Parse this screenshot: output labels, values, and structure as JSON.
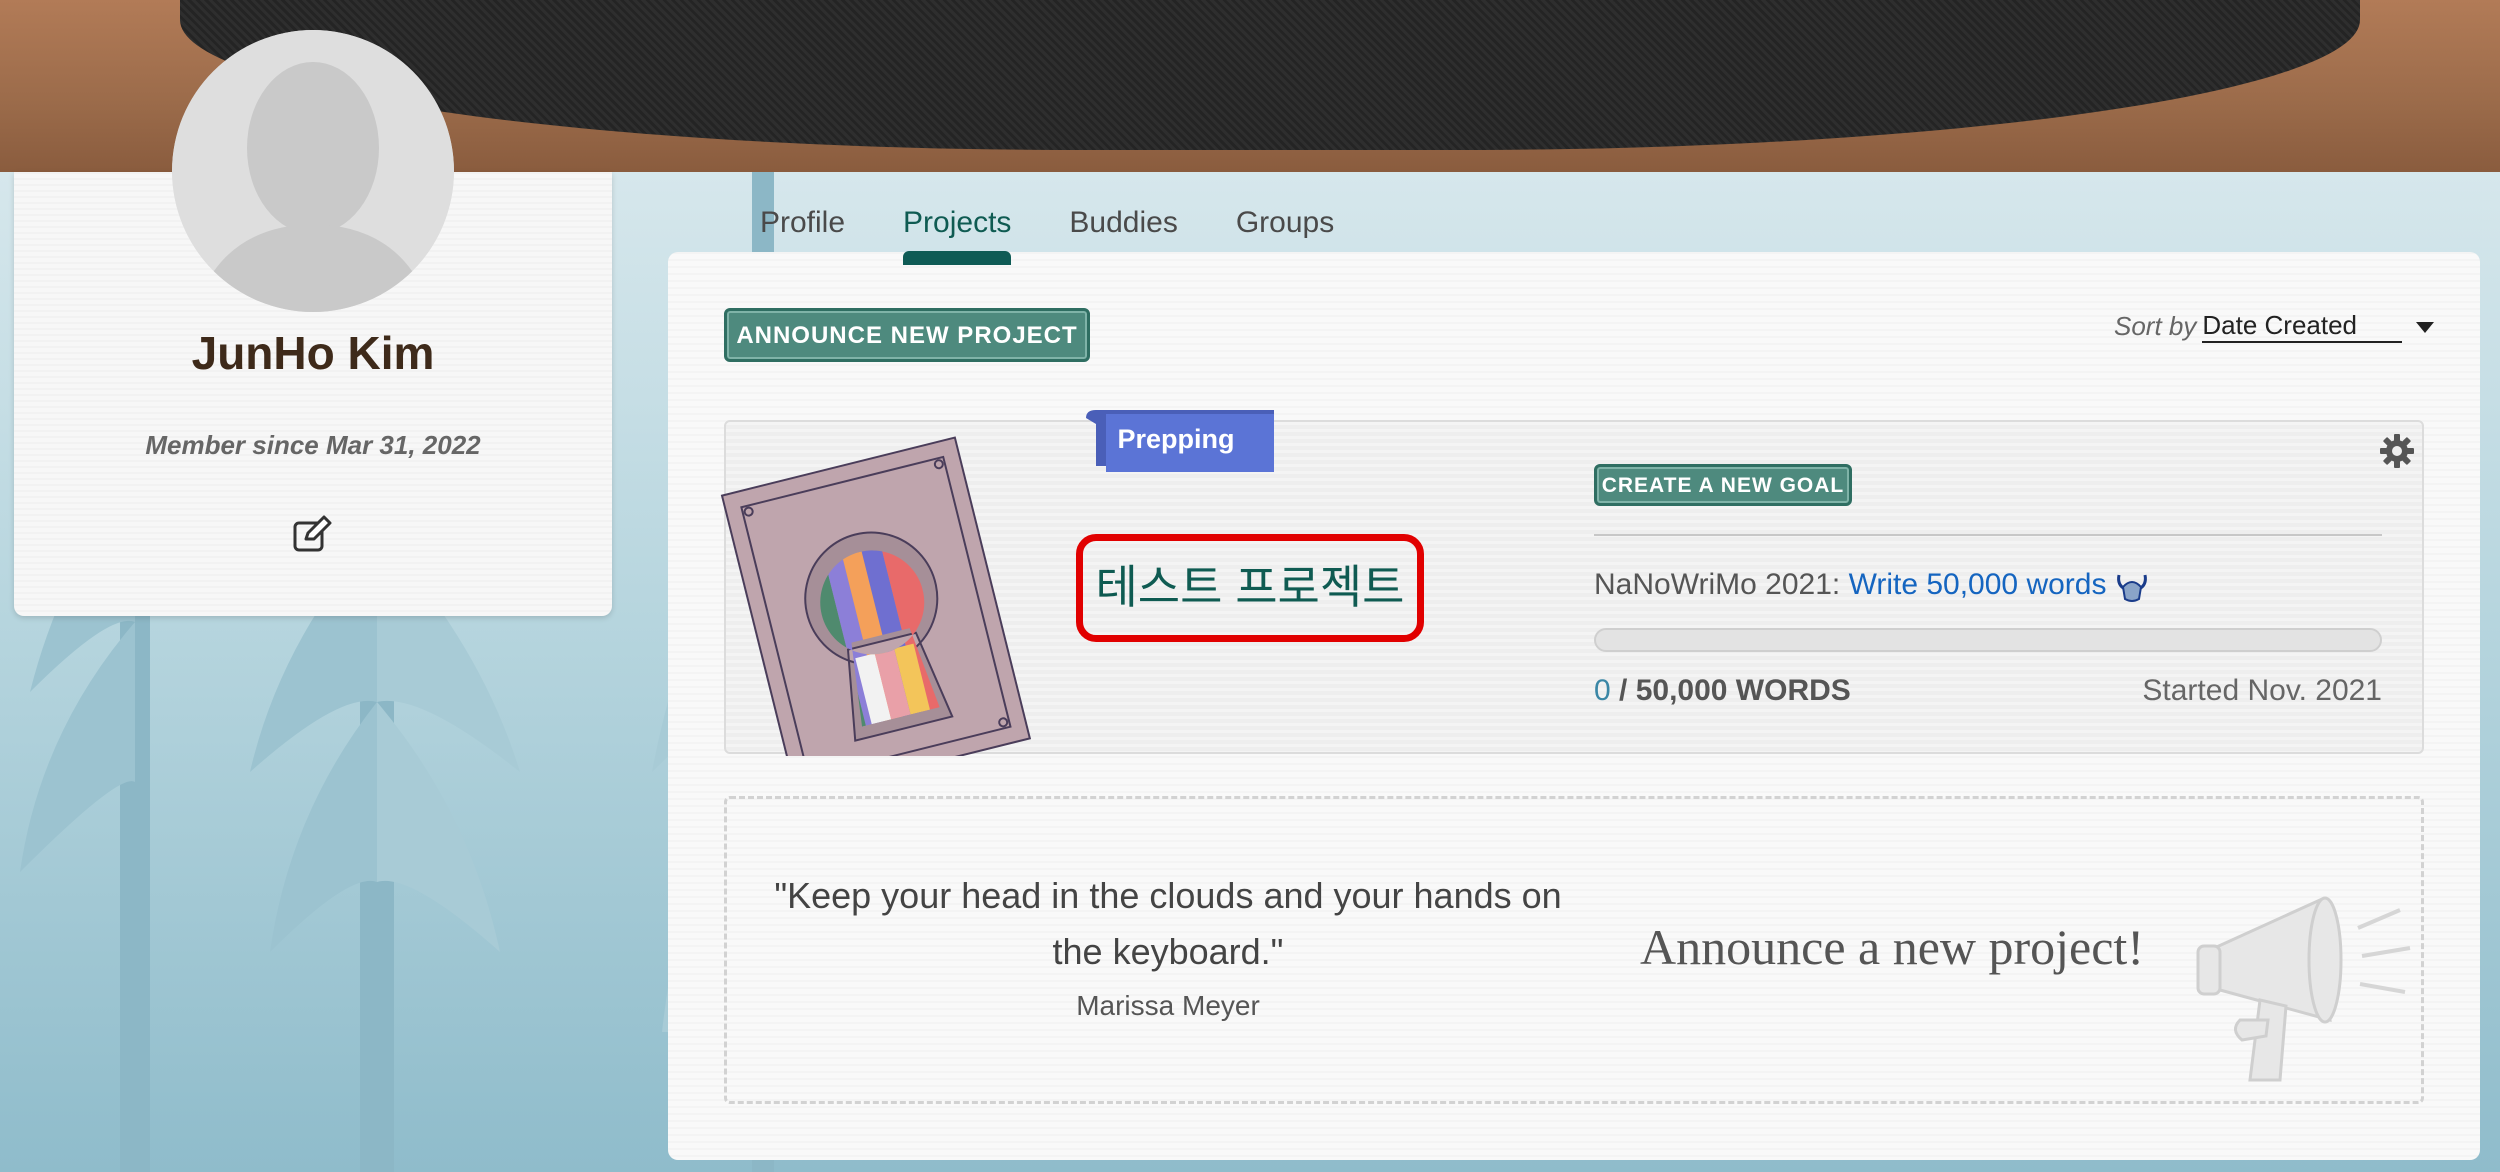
{
  "user": {
    "name": "JunHo Kim",
    "member_since": "Member since Mar 31, 2022"
  },
  "tabs": [
    {
      "label": "Profile",
      "active": false
    },
    {
      "label": "Projects",
      "active": true
    },
    {
      "label": "Buddies",
      "active": false
    },
    {
      "label": "Groups",
      "active": false
    }
  ],
  "toolbar": {
    "announce_label": "ANNOUNCE NEW PROJECT",
    "sort_label": "Sort by",
    "sort_value": "Date Created"
  },
  "project": {
    "status": "Prepping",
    "title": "테스트 프로젝트",
    "create_goal_label": "CREATE A NEW GOAL",
    "goal_event": "NaNoWriMo 2021:",
    "goal_link": "Write 50,000 words",
    "progress_fraction": 0,
    "words_current": "0",
    "words_total": "/ 50,000 WORDS",
    "started": "Started Nov. 2021"
  },
  "prompt": {
    "quote": "\"Keep your head in the clouds and your hands on the keyboard.\"",
    "author": "Marissa Meyer",
    "cta": "Announce a new project!"
  },
  "colors": {
    "accent": "#0f5b52",
    "button": "#4e8a7e",
    "status_ribbon": "#5b74d6",
    "highlight_box": "#e10000",
    "link": "#1565c0"
  },
  "icons": {
    "edit": "edit-icon",
    "gear": "gear-icon",
    "badge": "viking-helmet-icon",
    "megaphone": "megaphone-icon"
  }
}
